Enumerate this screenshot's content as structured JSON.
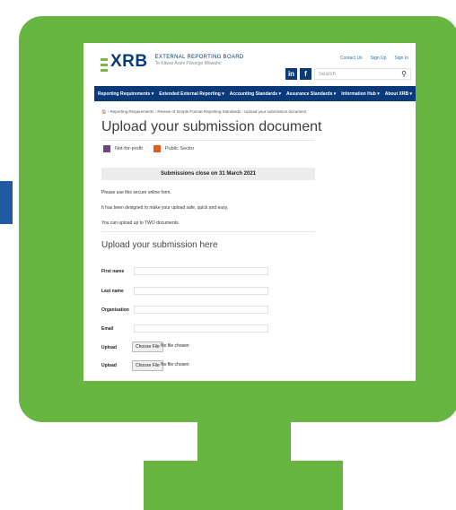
{
  "colors": {
    "frame": "#69b541",
    "brand_navy": "#0a3a7a",
    "accent_blue": "#1f5aa3",
    "not_for_profit": "#6b4a7a",
    "public_sector": "#e55a1e"
  },
  "header": {
    "logo_text": "XRB",
    "logo_line1": "EXTERNAL REPORTING BOARD",
    "logo_line2": "Te Kāwai Ārahi Pūrongo Mōwaho",
    "top_links": [
      "Contact Us",
      "Sign Up",
      "Sign In"
    ],
    "social": [
      "in",
      "f"
    ],
    "search_placeholder": "Search",
    "search_icon": "magnifier-icon"
  },
  "nav": {
    "items": [
      "Reporting Requirements ▾",
      "Extended External Reporting ▾",
      "Accounting Standards ▾",
      "Assurance Standards ▾",
      "Information Hub ▾",
      "About XRB ▾"
    ]
  },
  "page": {
    "breadcrumb": "🏠 › Reporting Requirements › Review of Simple Format Reporting Standards › Upload your submission document",
    "title": "Upload your submission document",
    "tags": [
      "Not-for-profit",
      "Public Sector"
    ],
    "banner": "Submissions close on 31 March 2021",
    "paragraphs": [
      "Please use this secure online form.",
      "It has been designed to make your upload safe, quick and easy.",
      "You can upload up to TWO documents."
    ],
    "form_title": "Upload your submission here"
  },
  "form": {
    "fields": [
      "First name",
      "Last name",
      "Organisation",
      "Email"
    ],
    "uploads": [
      {
        "label": "Upload",
        "button": "Choose File",
        "status": "No file chosen"
      },
      {
        "label": "Upload",
        "button": "Choose File",
        "status": "No file chosen"
      }
    ]
  }
}
